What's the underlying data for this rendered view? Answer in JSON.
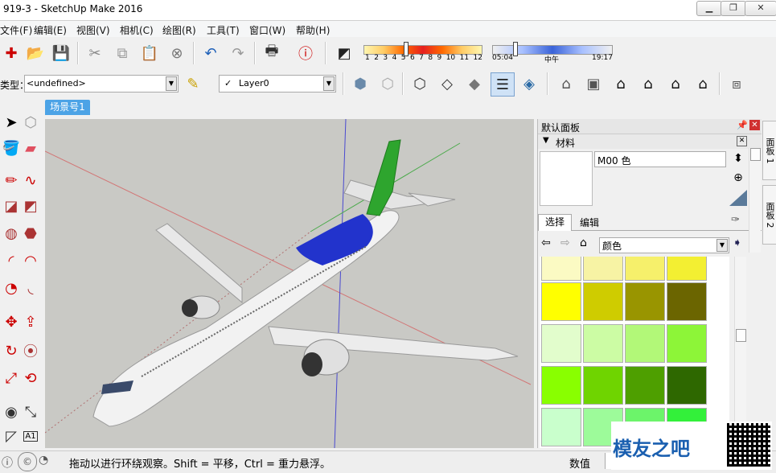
{
  "window": {
    "title": "919-3 - SketchUp Make 2016",
    "controls": [
      "minimize-icon",
      "restore-icon",
      "close-icon"
    ]
  },
  "menu": {
    "items": [
      "文件(F)",
      "编辑(E)",
      "视图(V)",
      "相机(C)",
      "绘图(R)",
      "工具(T)",
      "窗口(W)",
      "帮助(H)"
    ]
  },
  "shadow_bar": {
    "months": [
      "1",
      "2",
      "3",
      "4",
      "5",
      "6",
      "7",
      "8",
      "9",
      "10",
      "11",
      "12"
    ],
    "time_start": "05:04",
    "time_mid": "中午",
    "time_end": "19:17"
  },
  "entity_info": {
    "label": "类型：",
    "value": "<undefined>"
  },
  "layer": {
    "check": "✓",
    "value": "Layer0"
  },
  "scene_tab": {
    "label": "场景号1"
  },
  "panel": {
    "title": "默认面板",
    "section": "材料",
    "material_name": "M00 色",
    "tab_select": "选择",
    "tab_edit": "编辑",
    "library": "颜色",
    "swatch_colors": [
      [
        "#fbfac3",
        "#f7f3a4",
        "#f6f06b",
        "#f3ef32"
      ],
      [
        "#ffff00",
        "#cfcc00",
        "#999500",
        "#6b6500"
      ],
      [
        "#e2fdcc",
        "#ccfca4",
        "#b2f878",
        "#8df538"
      ],
      [
        "#89ff00",
        "#6fd400",
        "#4e9f00",
        "#2e6800"
      ],
      [
        "#c9ffcc",
        "#9dfb9a",
        "#6cf46a",
        "#33f03a"
      ]
    ]
  },
  "side_tabs": [
    "面板 1",
    "面板 2"
  ],
  "status": {
    "message": "拖动以进行环绕观察。Shift = 平移，Ctrl = 重力悬浮。",
    "value_label": "数值"
  },
  "watermark": {
    "text": "模友之吧"
  },
  "colors": {
    "accent_tab": "#4ca3e6",
    "canvas": "#c9c9c5",
    "tail_green": "#2ea52e",
    "cockpit_blue": "#2233cc"
  }
}
